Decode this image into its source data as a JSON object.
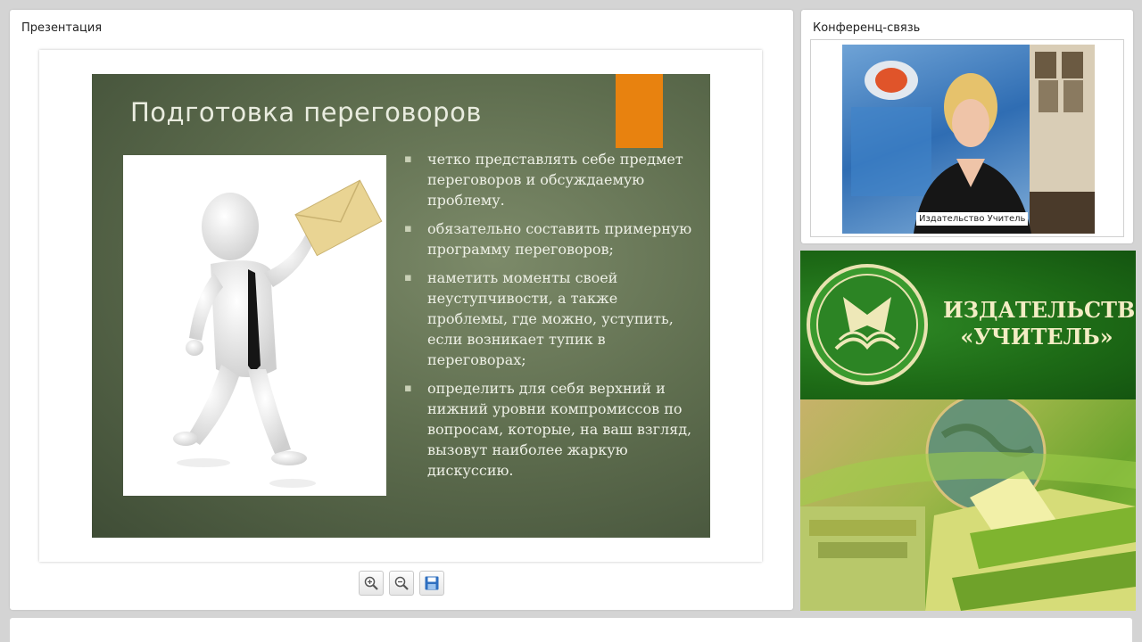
{
  "presentation": {
    "panel_title": "Презентация",
    "slide": {
      "title": "Подготовка переговоров",
      "bullets": [
        "четко представлять себе предмет переговоров и обсуждаемую проблему.",
        "обязательно составить примерную программу переговоров;",
        "наметить моменты своей неуступчивости, а также проблемы, где можно, уступить, если возникает тупик в переговорах;",
        " определить для себя верхний и нижний уровни компромиссов по вопросам, которые, на ваш взгляд, вызовут наиболее жаркую дискуссию."
      ],
      "bullet_marker": "▪"
    },
    "toolbar": {
      "icons": [
        "zoom-in-icon",
        "zoom-out-icon",
        "save-icon"
      ]
    }
  },
  "conference": {
    "panel_title": "Конференц-связь",
    "video_caption": "Издательство Учитель"
  },
  "banner": {
    "name_line1": "ИЗДАТЕЛЬСТВО",
    "name_line2": "«УЧИТЕЛЬ»",
    "colors": {
      "green": "#1d6a16",
      "text": "#f3edc4"
    }
  },
  "colors": {
    "accent_orange": "#e8820f",
    "slide_bg": "#5f6e4f"
  }
}
